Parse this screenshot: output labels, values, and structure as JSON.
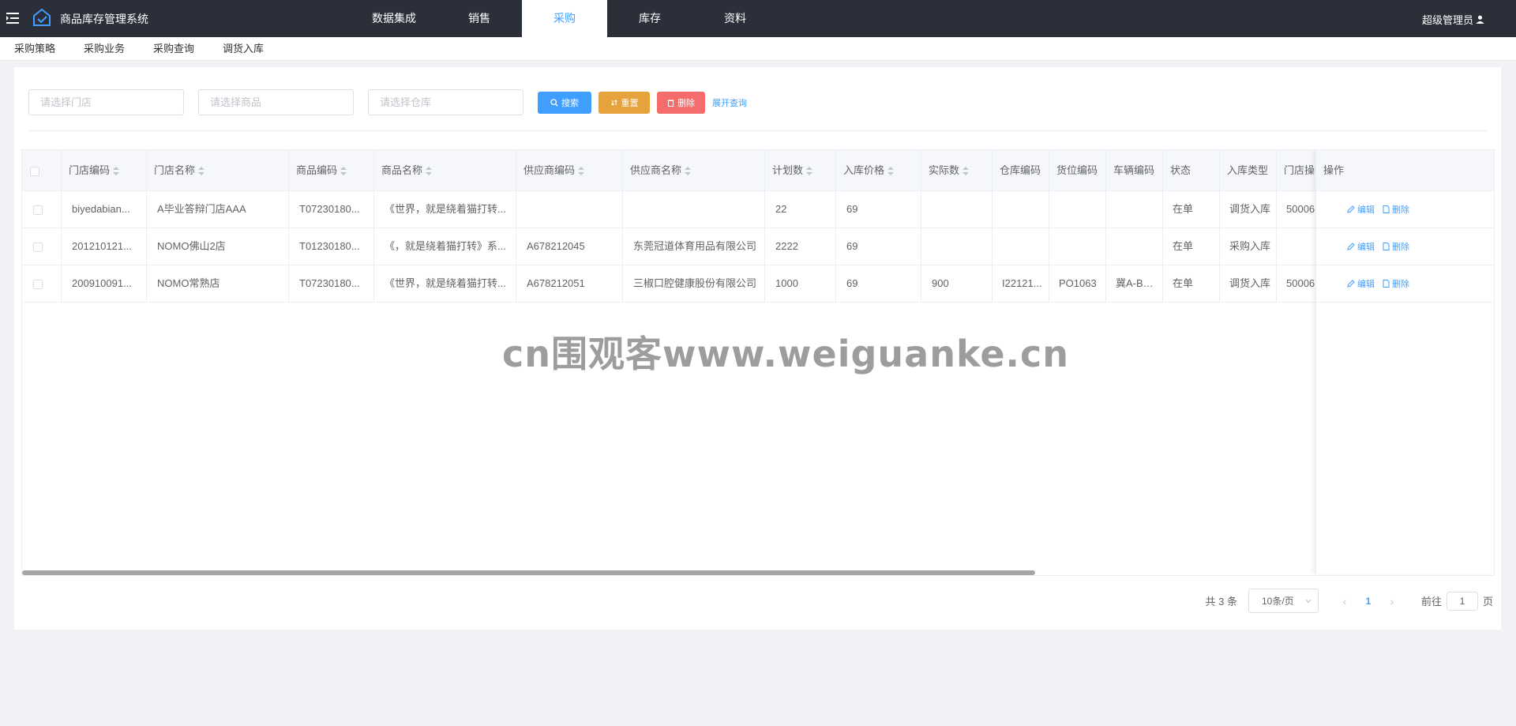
{
  "header": {
    "app_title": "商品库存管理系统",
    "nav": [
      "数据集成",
      "销售",
      "采购",
      "库存",
      "资料"
    ],
    "active_nav": "采购",
    "user": "超级管理员"
  },
  "subnav": [
    "采购策略",
    "采购业务",
    "采购查询",
    "调货入库"
  ],
  "filters": {
    "store_placeholder": "请选择门店",
    "product_placeholder": "请选择商品",
    "warehouse_placeholder": "请选择仓库",
    "search_label": "搜索",
    "reset_label": "重置",
    "delete_label": "删除",
    "expand_label": "展开查询"
  },
  "table": {
    "columns": [
      "门店编码",
      "门店名称",
      "商品编码",
      "商品名称",
      "供应商编码",
      "供应商名称",
      "计划数",
      "入库价格",
      "实际数",
      "仓库编码",
      "货位编码",
      "车辆编码",
      "状态",
      "入库类型",
      "门店操作"
    ],
    "action_header": "操作",
    "edit_label": "编辑",
    "delete_label": "删除",
    "rows": [
      [
        "biyedabian...",
        "A毕业答辩门店AAA",
        "T07230180...",
        "《世界，就是绕着猫打转...",
        "",
        "",
        "22",
        "69",
        "",
        "",
        "",
        "",
        "在单",
        "调货入库",
        "50006"
      ],
      [
        "201210121...",
        "NOMO佛山2店",
        "T01230180...",
        "《，就是绕着猫打转》系...",
        "A678212045",
        "东莞冠道体育用品有限公司",
        "2222",
        "69",
        "",
        "",
        "",
        "",
        "在单",
        "采购入库",
        ""
      ],
      [
        "200910091...",
        "NOMO常熟店",
        "T07230180...",
        "《世界，就是绕着猫打转...",
        "A678212051",
        "三椒口腔健康股份有限公司",
        "1000",
        "69",
        "900",
        "I22121...",
        "PO1063",
        "冀A-BB...",
        "在单",
        "调货入库",
        "50006"
      ]
    ]
  },
  "watermark": "cn围观客www.weiguanke.cn",
  "pagination": {
    "total": "共 3 条",
    "page_size": "10条/页",
    "current_page": "1",
    "goto_prefix": "前往",
    "goto_value": "1",
    "goto_suffix": "页"
  }
}
